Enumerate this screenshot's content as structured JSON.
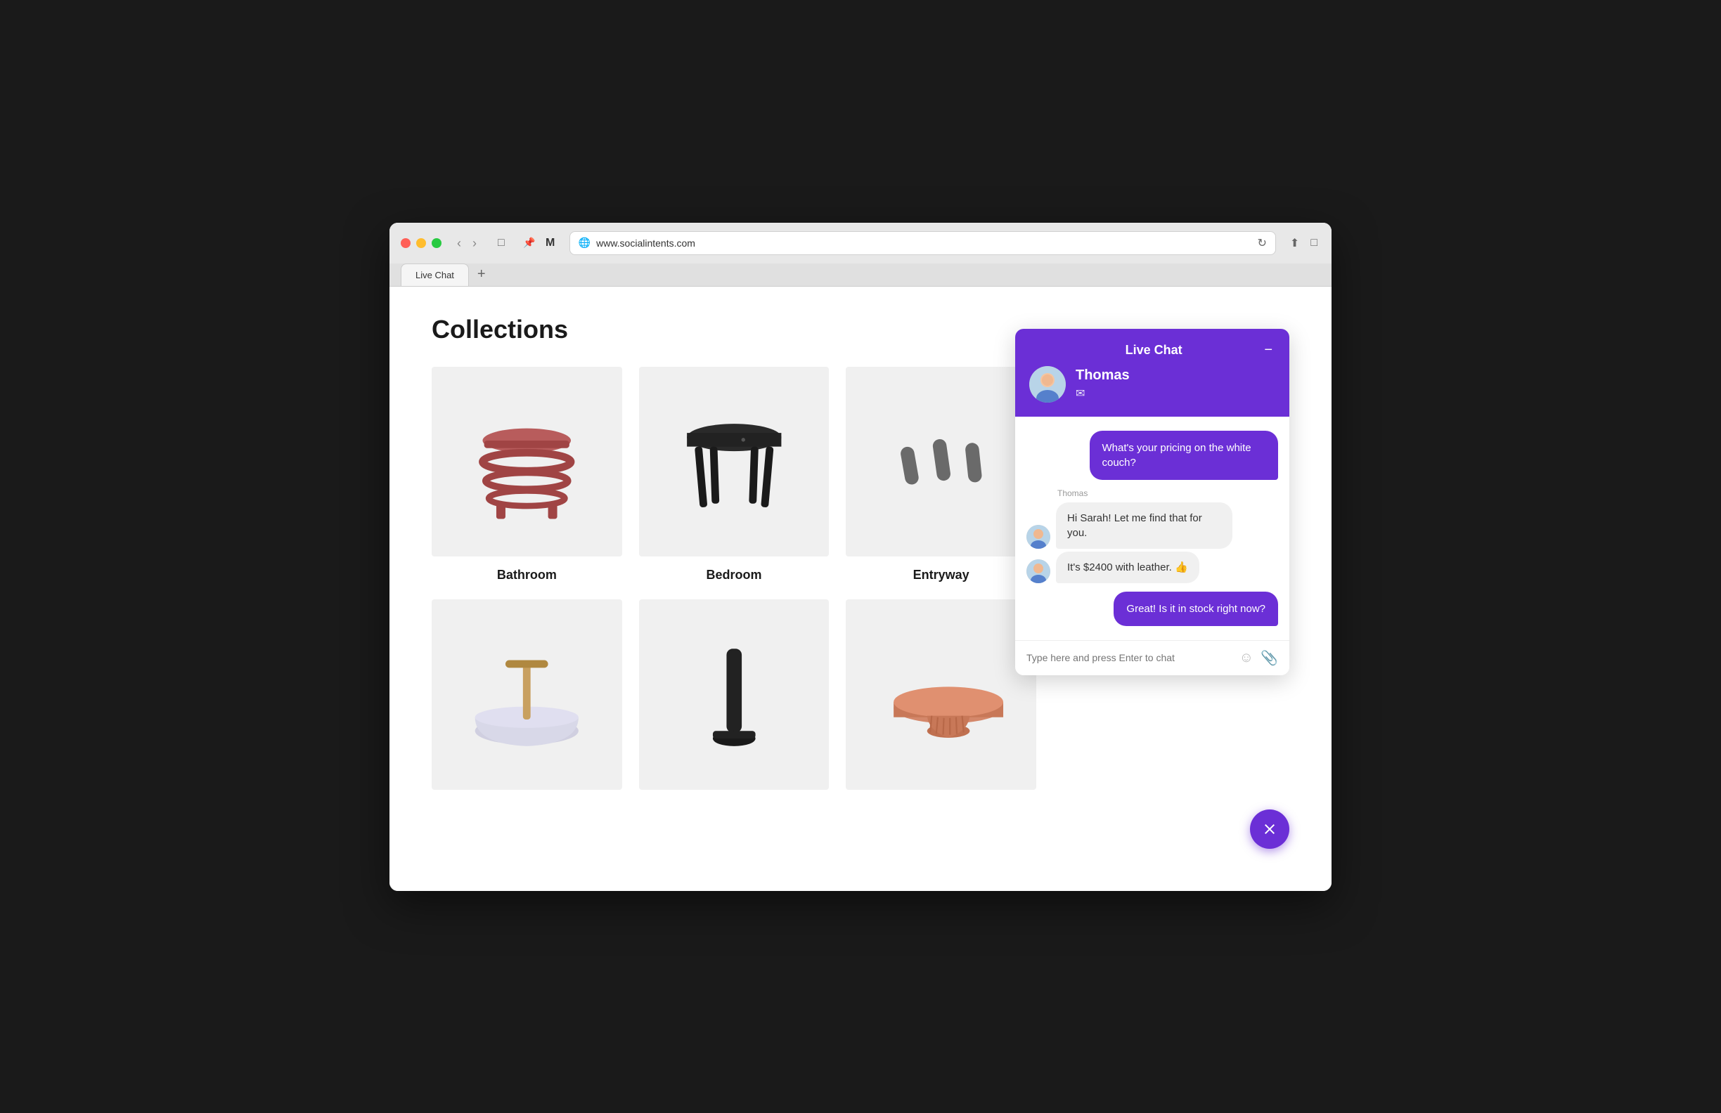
{
  "browser": {
    "url": "www.socialintents.com",
    "tab_label": "Live Chat",
    "new_tab_label": "+"
  },
  "page": {
    "title": "Collections",
    "collections": [
      {
        "id": "bathroom",
        "label": "Bathroom",
        "type": "stool-red"
      },
      {
        "id": "bedroom",
        "label": "Bedroom",
        "type": "stool-black"
      },
      {
        "id": "entryway",
        "label": "Entryway",
        "type": "hooks"
      },
      {
        "id": "row2-1",
        "label": "",
        "type": "bowl-tool"
      },
      {
        "id": "row2-2",
        "label": "",
        "type": "pole"
      },
      {
        "id": "row2-3",
        "label": "",
        "type": "table-round"
      }
    ]
  },
  "chat": {
    "title": "Live Chat",
    "minimize_label": "−",
    "agent_name": "Thomas",
    "agent_email_icon": "✉",
    "messages": [
      {
        "type": "user",
        "text": "What's your pricing on the white couch?"
      },
      {
        "type": "agent_label",
        "text": "Thomas"
      },
      {
        "type": "agent",
        "text": "Hi Sarah! Let me find that for you."
      },
      {
        "type": "agent_no_avatar",
        "text": "It's $2400 with leather. 👍"
      },
      {
        "type": "user",
        "text": "Great! Is it in stock right now?"
      }
    ],
    "input_placeholder": "Type here and press Enter to chat",
    "close_label": "×"
  },
  "colors": {
    "accent": "#6b2fd6",
    "user_bubble": "#6b2fd6",
    "agent_bubble": "#f0f0f0"
  }
}
